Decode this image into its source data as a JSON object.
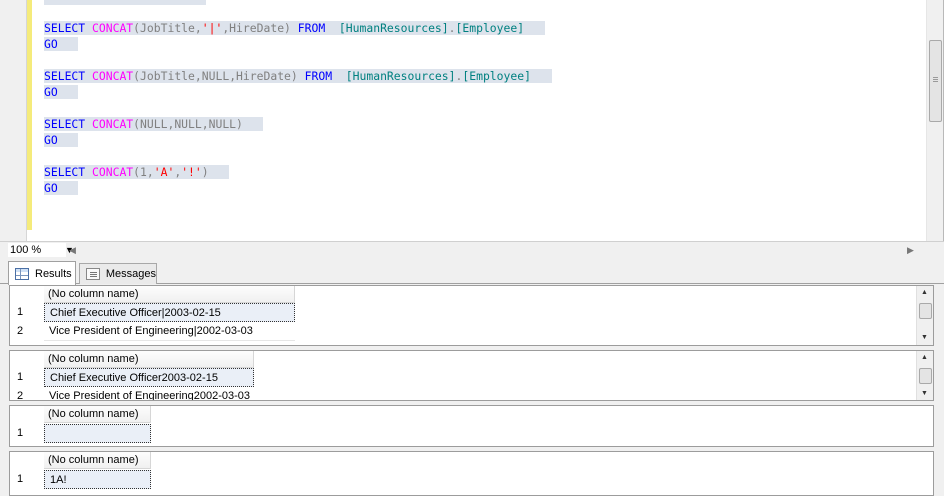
{
  "editor": {
    "lines": [
      [
        {
          "t": "SELECT",
          "c": "kw"
        },
        {
          "t": " ",
          "c": "plain"
        },
        {
          "t": "CONCAT",
          "c": "fn"
        },
        {
          "t": "(JobTitle,",
          "c": "gray"
        },
        {
          "t": "'|'",
          "c": "str"
        },
        {
          "t": ",HireDate)",
          "c": "gray"
        },
        {
          "t": " ",
          "c": "plain"
        },
        {
          "t": "FROM",
          "c": "kw"
        },
        {
          "t": "  ",
          "c": "plain"
        },
        {
          "t": "[HumanResources]",
          "c": "obj"
        },
        {
          "t": ".",
          "c": "gray"
        },
        {
          "t": "[Employee]",
          "c": "obj"
        }
      ],
      [
        {
          "t": "GO",
          "c": "kw"
        }
      ],
      [],
      [
        {
          "t": "SELECT",
          "c": "kw"
        },
        {
          "t": " ",
          "c": "plain"
        },
        {
          "t": "CONCAT",
          "c": "fn"
        },
        {
          "t": "(JobTitle,",
          "c": "gray"
        },
        {
          "t": "NULL",
          "c": "gray"
        },
        {
          "t": ",HireDate)",
          "c": "gray"
        },
        {
          "t": " ",
          "c": "plain"
        },
        {
          "t": "FROM",
          "c": "kw"
        },
        {
          "t": "  ",
          "c": "plain"
        },
        {
          "t": "[HumanResources]",
          "c": "obj"
        },
        {
          "t": ".",
          "c": "gray"
        },
        {
          "t": "[Employee]",
          "c": "obj"
        }
      ],
      [
        {
          "t": "GO",
          "c": "kw"
        }
      ],
      [],
      [
        {
          "t": "SELECT",
          "c": "kw"
        },
        {
          "t": " ",
          "c": "plain"
        },
        {
          "t": "CONCAT",
          "c": "fn"
        },
        {
          "t": "(NULL,NULL,NULL)",
          "c": "gray"
        }
      ],
      [
        {
          "t": "GO",
          "c": "kw"
        }
      ],
      [],
      [
        {
          "t": "SELECT",
          "c": "kw"
        },
        {
          "t": " ",
          "c": "plain"
        },
        {
          "t": "CONCAT",
          "c": "fn"
        },
        {
          "t": "(1,",
          "c": "gray"
        },
        {
          "t": "'A'",
          "c": "str"
        },
        {
          "t": ",",
          "c": "gray"
        },
        {
          "t": "'!'",
          "c": "str"
        },
        {
          "t": ")",
          "c": "gray"
        }
      ],
      [
        {
          "t": "GO",
          "c": "kw"
        }
      ]
    ]
  },
  "zoom": {
    "value": "100 %"
  },
  "tabs": {
    "results": "Results",
    "messages": "Messages"
  },
  "results": [
    {
      "column": "(No column name)",
      "rows": [
        {
          "num": "1",
          "value": "Chief Executive Officer|2003-02-15"
        },
        {
          "num": "2",
          "value": "Vice President of Engineering|2002-03-03"
        }
      ]
    },
    {
      "column": "(No column name)",
      "rows": [
        {
          "num": "1",
          "value": "Chief Executive Officer2003-02-15"
        },
        {
          "num": "2",
          "value": "Vice President of Engineering2002-03-03"
        }
      ]
    },
    {
      "column": "(No column name)",
      "rows": [
        {
          "num": "1",
          "value": ""
        }
      ]
    },
    {
      "column": "(No column name)",
      "rows": [
        {
          "num": "1",
          "value": "1A!"
        }
      ]
    }
  ]
}
